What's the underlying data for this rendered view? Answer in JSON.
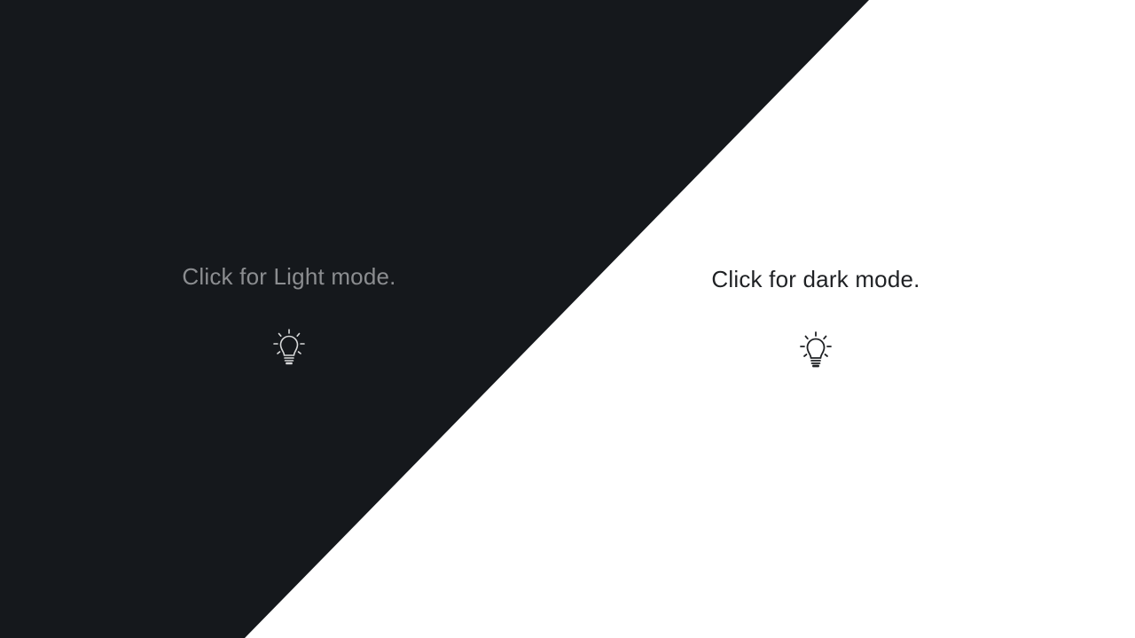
{
  "light_mode_prompt": {
    "label": "Click for Light mode.",
    "icon": "lightbulb-icon",
    "text_color": "#8b8d90"
  },
  "dark_mode_prompt": {
    "label": "Click for dark mode.",
    "icon": "lightbulb-icon",
    "text_color": "#1f2124"
  },
  "colors": {
    "dark_background": "#15181c",
    "light_background": "#ffffff"
  }
}
